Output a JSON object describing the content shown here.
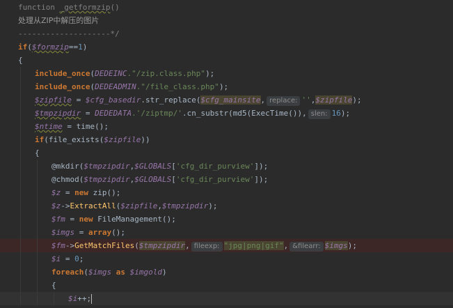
{
  "editor": {
    "lines": [
      {
        "indent": 0,
        "tokens": [
          {
            "c": "cm",
            "t": "function "
          },
          {
            "c": "cm squig",
            "t": "_getformzip"
          },
          {
            "c": "cm",
            "t": "()"
          }
        ]
      },
      {
        "indent": 0,
        "tokens": [
          {
            "c": "cm-cn",
            "t": "处理从ZIP中解压的图片"
          }
        ]
      },
      {
        "indent": 0,
        "tokens": [
          {
            "c": "cm",
            "t": "--------------------*/"
          }
        ]
      },
      {
        "indent": 0,
        "tokens": [
          {
            "c": "kw",
            "t": "if"
          },
          {
            "c": "plain",
            "t": "("
          },
          {
            "c": "var squig",
            "t": "$formzip"
          },
          {
            "c": "plain",
            "t": "=="
          },
          {
            "c": "num",
            "t": "1"
          },
          {
            "c": "plain",
            "t": ")"
          }
        ]
      },
      {
        "indent": 0,
        "tokens": [
          {
            "c": "plain",
            "t": "{"
          }
        ]
      },
      {
        "indent": 1,
        "tokens": [
          {
            "c": "kw",
            "t": "include_once"
          },
          {
            "c": "plain",
            "t": "("
          },
          {
            "c": "cst",
            "t": "DEDEINC"
          },
          {
            "c": "str",
            "t": ".\"/zip.class.php\""
          },
          {
            "c": "plain",
            "t": ");"
          }
        ]
      },
      {
        "indent": 1,
        "tokens": [
          {
            "c": "kw",
            "t": "include_once"
          },
          {
            "c": "plain",
            "t": "("
          },
          {
            "c": "cst",
            "t": "DEDEADMIN"
          },
          {
            "c": "str",
            "t": ".\"/file_class.php\""
          },
          {
            "c": "plain",
            "t": ");"
          }
        ]
      },
      {
        "indent": 1,
        "tokens": [
          {
            "c": "var squig",
            "t": "$zipfile"
          },
          {
            "c": "plain",
            "t": " = "
          },
          {
            "c": "var",
            "t": "$cfg_basedir"
          },
          {
            "c": "plain",
            "t": ".str_replace("
          },
          {
            "c": "var hl",
            "t": "$cfg_mainsite"
          },
          {
            "c": "plain",
            "t": ","
          },
          {
            "c": "hint",
            "t": "replace:"
          },
          {
            "c": "str",
            "t": "''"
          },
          {
            "c": "plain",
            "t": ","
          },
          {
            "c": "var hl",
            "t": "$zipfile"
          },
          {
            "c": "plain",
            "t": ");"
          }
        ]
      },
      {
        "indent": 1,
        "tokens": [
          {
            "c": "var squig",
            "t": "$tmpzipdir"
          },
          {
            "c": "plain",
            "t": " = "
          },
          {
            "c": "cst",
            "t": "DEDEDATA"
          },
          {
            "c": "str",
            "t": ".'/ziptmp/'"
          },
          {
            "c": "plain",
            "t": ".cn_substr(md5(ExecTime()),"
          },
          {
            "c": "hint",
            "t": "slen:"
          },
          {
            "c": "num",
            "t": "16"
          },
          {
            "c": "plain",
            "t": ");"
          }
        ]
      },
      {
        "indent": 1,
        "tokens": [
          {
            "c": "var squig",
            "t": "$ntime"
          },
          {
            "c": "plain",
            "t": " = time();"
          }
        ]
      },
      {
        "indent": 1,
        "tokens": [
          {
            "c": "kw",
            "t": "if"
          },
          {
            "c": "plain",
            "t": "(file_exists("
          },
          {
            "c": "var",
            "t": "$zipfile"
          },
          {
            "c": "plain",
            "t": "))"
          }
        ]
      },
      {
        "indent": 1,
        "tokens": [
          {
            "c": "plain",
            "t": "{"
          }
        ]
      },
      {
        "indent": 2,
        "tokens": [
          {
            "c": "plain",
            "t": "@mkdir("
          },
          {
            "c": "var",
            "t": "$tmpzipdir"
          },
          {
            "c": "plain",
            "t": ","
          },
          {
            "c": "var",
            "t": "$GLOBALS"
          },
          {
            "c": "plain",
            "t": "["
          },
          {
            "c": "str",
            "t": "'cfg_dir_purview'"
          },
          {
            "c": "plain",
            "t": "]);"
          }
        ]
      },
      {
        "indent": 2,
        "tokens": [
          {
            "c": "plain",
            "t": "@chmod("
          },
          {
            "c": "var",
            "t": "$tmpzipdir"
          },
          {
            "c": "plain",
            "t": ","
          },
          {
            "c": "var",
            "t": "$GLOBALS"
          },
          {
            "c": "plain",
            "t": "["
          },
          {
            "c": "str",
            "t": "'cfg_dir_purview'"
          },
          {
            "c": "plain",
            "t": "]);"
          }
        ]
      },
      {
        "indent": 2,
        "tokens": [
          {
            "c": "var",
            "t": "$z"
          },
          {
            "c": "plain",
            "t": " = "
          },
          {
            "c": "kw",
            "t": "new"
          },
          {
            "c": "plain",
            "t": " zip();"
          }
        ]
      },
      {
        "indent": 2,
        "tokens": [
          {
            "c": "var",
            "t": "$z"
          },
          {
            "c": "plain",
            "t": "->"
          },
          {
            "c": "fn",
            "t": "ExtractAll"
          },
          {
            "c": "plain",
            "t": "("
          },
          {
            "c": "var",
            "t": "$zipfile"
          },
          {
            "c": "plain",
            "t": ","
          },
          {
            "c": "var",
            "t": "$tmpzipdir"
          },
          {
            "c": "plain",
            "t": ");"
          }
        ]
      },
      {
        "indent": 2,
        "tokens": [
          {
            "c": "var",
            "t": "$fm"
          },
          {
            "c": "plain",
            "t": " = "
          },
          {
            "c": "kw",
            "t": "new"
          },
          {
            "c": "plain",
            "t": " FileManagement();"
          }
        ]
      },
      {
        "indent": 2,
        "tokens": [
          {
            "c": "var",
            "t": "$imgs"
          },
          {
            "c": "plain",
            "t": " = "
          },
          {
            "c": "kw",
            "t": "array"
          },
          {
            "c": "plain",
            "t": "();"
          }
        ]
      },
      {
        "indent": 2,
        "error": true,
        "tokens": [
          {
            "c": "var",
            "t": "$fm"
          },
          {
            "c": "plain",
            "t": "->"
          },
          {
            "c": "fn",
            "t": "GetMatchFiles"
          },
          {
            "c": "plain",
            "t": "("
          },
          {
            "c": "var hl",
            "t": "$tmpzipdir"
          },
          {
            "c": "plain",
            "t": ","
          },
          {
            "c": "hint",
            "t": "fileexp:"
          },
          {
            "c": "str hl",
            "t": "\"jpg|png|gif\""
          },
          {
            "c": "plain",
            "t": ","
          },
          {
            "c": "hint",
            "t": "&filearr:"
          },
          {
            "c": "var hl",
            "t": "$imgs"
          },
          {
            "c": "plain",
            "t": ");"
          }
        ]
      },
      {
        "indent": 2,
        "tokens": [
          {
            "c": "var",
            "t": "$i"
          },
          {
            "c": "plain",
            "t": " = "
          },
          {
            "c": "num",
            "t": "0"
          },
          {
            "c": "plain",
            "t": ";"
          }
        ]
      },
      {
        "indent": 2,
        "tokens": [
          {
            "c": "kw",
            "t": "foreach"
          },
          {
            "c": "plain",
            "t": "("
          },
          {
            "c": "var",
            "t": "$imgs"
          },
          {
            "c": "plain",
            "t": " "
          },
          {
            "c": "kw",
            "t": "as"
          },
          {
            "c": "plain",
            "t": " "
          },
          {
            "c": "var",
            "t": "$imgold"
          },
          {
            "c": "plain",
            "t": ")"
          }
        ]
      },
      {
        "indent": 2,
        "tokens": [
          {
            "c": "plain",
            "t": "{"
          }
        ]
      },
      {
        "indent": 3,
        "current": true,
        "cursor": true,
        "tokens": [
          {
            "c": "var",
            "t": "$i"
          },
          {
            "c": "plain",
            "t": "++;"
          }
        ]
      }
    ]
  }
}
